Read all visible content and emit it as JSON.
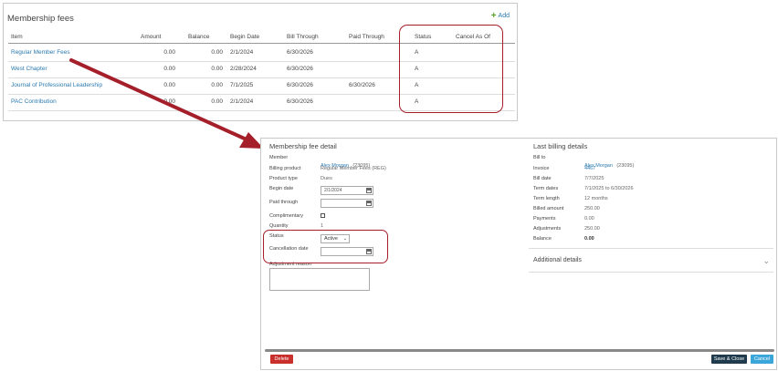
{
  "fees": {
    "title": "Membership fees",
    "add_label": "Add",
    "columns": [
      "Item",
      "Amount",
      "Balance",
      "Begin Date",
      "Bill Through",
      "Paid Through",
      "Status",
      "Cancel As Of"
    ],
    "rows": [
      {
        "item": "Regular Member Fees",
        "amount": "0.00",
        "balance": "0.00",
        "begin": "2/1/2024",
        "bill_through": "6/30/2026",
        "paid_through": "",
        "status": "A",
        "cancel": ""
      },
      {
        "item": "West Chapter",
        "amount": "0.00",
        "balance": "0.00",
        "begin": "2/28/2024",
        "bill_through": "6/30/2026",
        "paid_through": "",
        "status": "A",
        "cancel": ""
      },
      {
        "item": "Journal of Professional Leadership",
        "amount": "0.00",
        "balance": "0.00",
        "begin": "7/1/2025",
        "bill_through": "6/30/2026",
        "paid_through": "6/30/2026",
        "status": "A",
        "cancel": ""
      },
      {
        "item": "PAC Contribution",
        "amount": "0.00",
        "balance": "0.00",
        "begin": "2/1/2024",
        "bill_through": "6/30/2026",
        "paid_through": "",
        "status": "A",
        "cancel": ""
      }
    ]
  },
  "detail": {
    "title": "Membership fee detail",
    "member_label": "Member",
    "member_name": "Alex Morgan",
    "member_id": "(23095)",
    "billing_product_label": "Billing product",
    "billing_product": "Regular Member Fees (REG)",
    "product_type_label": "Product type",
    "product_type": "Dues",
    "begin_date_label": "Begin date",
    "begin_date": "2/1/2024",
    "paid_through_label": "Paid through",
    "paid_through": "",
    "complimentary_label": "Complimentary",
    "quantity_label": "Quantity",
    "quantity": "1",
    "status_label": "Status",
    "status_value": "Active",
    "cancellation_label": "Cancellation date",
    "cancellation_date": "",
    "adjustment_label": "Adjustment reason"
  },
  "billing": {
    "title": "Last billing details",
    "bill_to_label": "Bill to",
    "bill_to_name": "Alex Morgan",
    "bill_to_id": "(23095)",
    "invoice_label": "Invoice",
    "invoice": "4467",
    "bill_date_label": "Bill date",
    "bill_date": "7/7/2025",
    "term_dates_label": "Term dates",
    "term_dates": "7/1/2025 to 6/30/2026",
    "term_length_label": "Term length",
    "term_length": "12 months",
    "billed_amount_label": "Billed amount",
    "billed_amount": "250.00",
    "payments_label": "Payments",
    "payments": "0.00",
    "adjustments_label": "Adjustments",
    "adjustments": "250.00",
    "balance_label": "Balance",
    "balance": "0.00"
  },
  "additional_details": "Additional details",
  "buttons": {
    "delete": "Delete",
    "save_close": "Save & Close",
    "cancel": "Cancel"
  },
  "colors": {
    "link": "#2a7ab0",
    "highlight": "#a51f2b",
    "delete": "#c9302c",
    "save": "#1f3b4d",
    "cancel": "#3aa6d9"
  }
}
